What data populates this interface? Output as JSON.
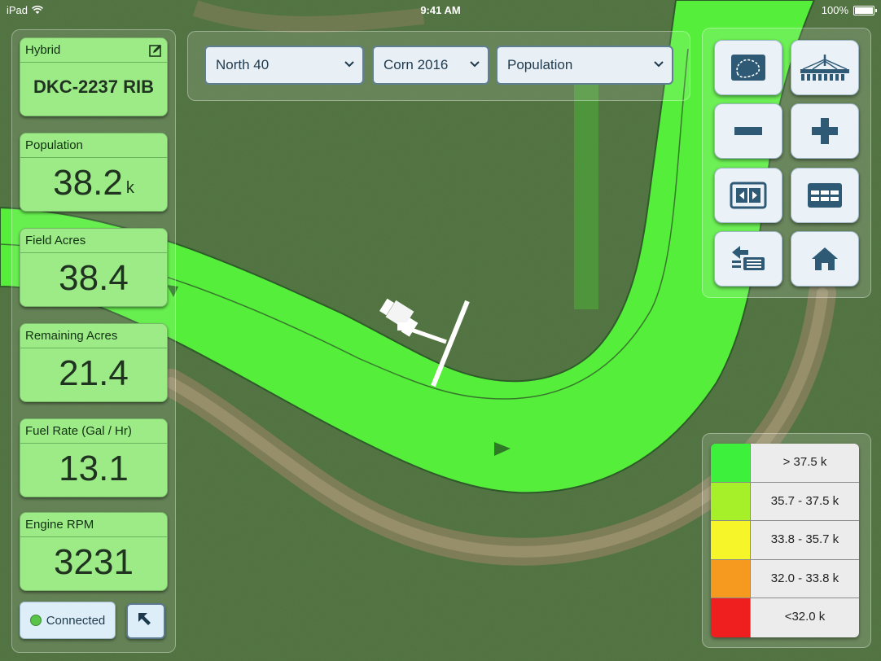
{
  "status_bar": {
    "device": "iPad",
    "time": "9:41 AM",
    "battery": "100%",
    "battery_level": 1.0
  },
  "left_panel": {
    "tiles": [
      {
        "label": "Hybrid",
        "value": "DKC-2237 RIB",
        "unit": ""
      },
      {
        "label": "Population",
        "value": "38.2",
        "unit": "k"
      },
      {
        "label": "Field Acres",
        "value": "38.4",
        "unit": ""
      },
      {
        "label": "Remaining Acres",
        "value": "21.4",
        "unit": ""
      },
      {
        "label": "Fuel Rate (Gal / Hr)",
        "value": "13.1",
        "unit": ""
      },
      {
        "label": "Engine RPM",
        "value": "3231",
        "unit": ""
      }
    ],
    "connection_status": "Connected"
  },
  "selectors": {
    "field": "North 40",
    "season": "Corn 2016",
    "layer": "Population"
  },
  "toolbar": {
    "buttons": [
      {
        "icon": "field-map-icon"
      },
      {
        "icon": "planter-icon"
      },
      {
        "icon": "minus-icon"
      },
      {
        "icon": "plus-icon"
      },
      {
        "icon": "fit-to-screen-icon"
      },
      {
        "icon": "table-icon"
      },
      {
        "icon": "layer-switch-icon"
      },
      {
        "icon": "home-icon"
      }
    ]
  },
  "legend": {
    "entries": [
      {
        "label": "> 37.5 k",
        "color": "#3cf03c"
      },
      {
        "label": "35.7 - 37.5 k",
        "color": "#a6f02a"
      },
      {
        "label": "33.8 - 35.7 k",
        "color": "#f5f52a"
      },
      {
        "label": "32.0 - 33.8 k",
        "color": "#f59a1f"
      },
      {
        "label": "<32.0 k",
        "color": "#ef1f1f"
      }
    ]
  },
  "colors": {
    "coverage": "#55ee3a",
    "tile": "#9deb87",
    "button": "#eaf2f8",
    "accent_border": "#5f7f95"
  }
}
